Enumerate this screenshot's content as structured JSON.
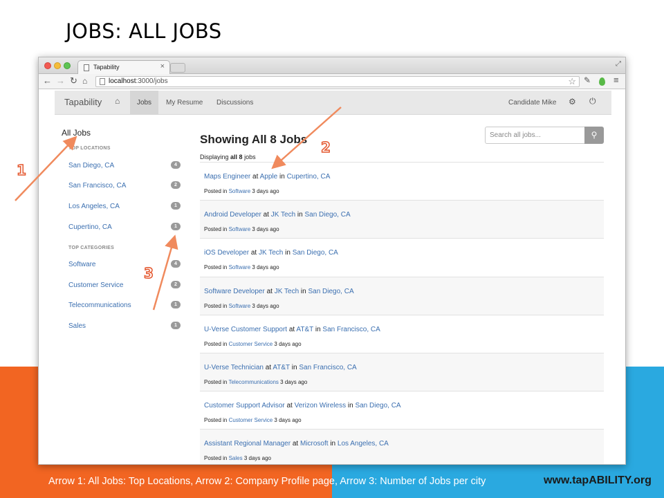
{
  "slide": {
    "title": "JOBS: ALL JOBS",
    "caption": "Arrow 1: All Jobs: Top Locations, Arrow 2: Company Profile page, Arrow 3: Number of Jobs per city",
    "site": "www.tapABILITY.org",
    "colors": {
      "orange_band": "#f26522",
      "blue_band": "#2aa9e0",
      "arrow": "#f08a5d",
      "number_label": "#e4572e"
    },
    "annotation_numbers": [
      "1",
      "2",
      "3"
    ]
  },
  "browser": {
    "tab_title": "Tapability",
    "tab_close": "×",
    "url_host": "localhost",
    "url_path": ":3000/jobs",
    "icons": [
      "back-arrow-icon",
      "forward-arrow-icon",
      "reload-icon",
      "home-icon",
      "bookmark-star-icon",
      "wrench-icon",
      "leaf-extension-icon",
      "menu-icon"
    ]
  },
  "navbar": {
    "brand": "Tapability",
    "items": [
      "Jobs",
      "My Resume",
      "Discussions"
    ],
    "active": "Jobs",
    "user": "Candidate Mike"
  },
  "sidebar": {
    "title": "All Jobs",
    "locations_heading": "TOP LOCATIONS",
    "locations": [
      {
        "label": "San Diego, CA",
        "count": "4"
      },
      {
        "label": "San Francisco, CA",
        "count": "2"
      },
      {
        "label": "Los Angeles, CA",
        "count": "1"
      },
      {
        "label": "Cupertino, CA",
        "count": "1"
      }
    ],
    "categories_heading": "TOP CATEGORIES",
    "categories": [
      {
        "label": "Software",
        "count": "4"
      },
      {
        "label": "Customer Service",
        "count": "2"
      },
      {
        "label": "Telecommunications",
        "count": "1"
      },
      {
        "label": "Sales",
        "count": "1"
      }
    ]
  },
  "main": {
    "heading": "Showing All 8 Jobs",
    "displaying_prefix": "Displaying",
    "displaying_count": "all 8",
    "displaying_suffix": "jobs",
    "search_placeholder": "Search all jobs...",
    "jobs": [
      {
        "title": "Maps Engineer",
        "company": "Apple",
        "location": "Cupertino, CA",
        "category": "Software",
        "age": "3 days ago"
      },
      {
        "title": "Android Developer",
        "company": "JK Tech",
        "location": "San Diego, CA",
        "category": "Software",
        "age": "3 days ago"
      },
      {
        "title": "iOS Developer",
        "company": "JK Tech",
        "location": "San Diego, CA",
        "category": "Software",
        "age": "3 days ago"
      },
      {
        "title": "Software Developer",
        "company": "JK Tech",
        "location": "San Diego, CA",
        "category": "Software",
        "age": "3 days ago"
      },
      {
        "title": "U-Verse Customer Support",
        "company": "AT&T",
        "location": "San Francisco, CA",
        "category": "Customer Service",
        "age": "3 days ago"
      },
      {
        "title": "U-Verse Technician",
        "company": "AT&T",
        "location": "San Francisco, CA",
        "category": "Telecommunications",
        "age": "3 days ago"
      },
      {
        "title": "Customer Support Advisor",
        "company": "Verizon Wireless",
        "location": "San Diego, CA",
        "category": "Customer Service",
        "age": "3 days ago"
      },
      {
        "title": "Assistant Regional Manager",
        "company": "Microsoft",
        "location": "Los Angeles, CA",
        "category": "Sales",
        "age": "3 days ago"
      }
    ],
    "word_at": "at",
    "word_in": "in",
    "word_posted": "Posted in"
  }
}
